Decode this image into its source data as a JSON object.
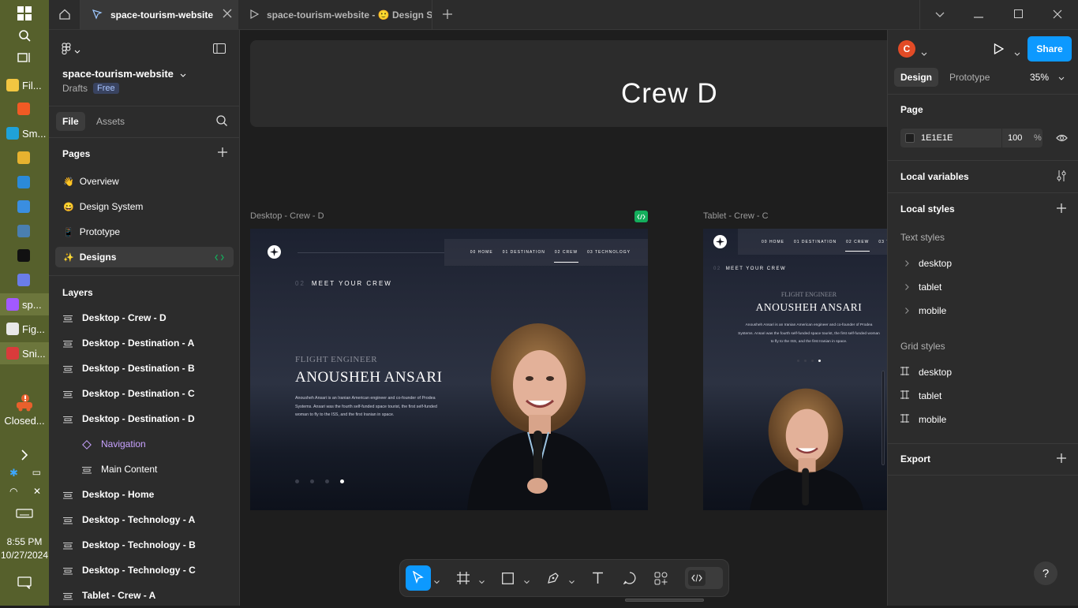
{
  "taskbar": {
    "apps": [
      {
        "label": "Fil...",
        "icon": "folder-icon",
        "color": "#f2c641"
      },
      {
        "label": "",
        "icon": "brave-icon",
        "color": "#f15a24"
      },
      {
        "label": "Sm...",
        "icon": "edge-icon",
        "color": "#1fa2d8"
      },
      {
        "label": "",
        "icon": "chrome-icon",
        "color": "#e7b22f"
      },
      {
        "label": "",
        "icon": "vscode-icon",
        "color": "#2b8ad8"
      },
      {
        "label": "",
        "icon": "store-icon",
        "color": "#3a8ee0"
      },
      {
        "label": "",
        "icon": "python-icon",
        "color": "#4a7fb0"
      },
      {
        "label": "",
        "icon": "app-icon",
        "color": "#111111"
      },
      {
        "label": "",
        "icon": "copilot-icon",
        "color": "#6a7de8"
      },
      {
        "label": "sp...",
        "icon": "figma-icon",
        "color": "#a259ff"
      },
      {
        "label": "Fig...",
        "icon": "figma-window-icon",
        "color": "#e8e8e8"
      },
      {
        "label": "Sni...",
        "icon": "snipping-icon",
        "color": "#d93b3b"
      }
    ],
    "closed_label": "Closed...",
    "time": "8:55 PM",
    "date": "10/27/2024"
  },
  "tabs": {
    "active": "space-tourism-website",
    "inactive": "space-tourism-website - 🙂 Design S"
  },
  "left": {
    "file_name": "space-tourism-website",
    "drafts": "Drafts",
    "plan": "Free",
    "file_tab": "File",
    "assets_tab": "Assets",
    "pages_title": "Pages",
    "pages": [
      {
        "emoji": "👋",
        "label": "Overview"
      },
      {
        "emoji": "😀",
        "label": "Design System"
      },
      {
        "emoji": "📱",
        "label": "Prototype"
      },
      {
        "emoji": "✨",
        "label": "Designs"
      }
    ],
    "layers_title": "Layers",
    "layers": [
      {
        "label": "Desktop - Crew - D",
        "indent": 0,
        "kind": "frame"
      },
      {
        "label": "Desktop - Destination - A",
        "indent": 0,
        "kind": "frame"
      },
      {
        "label": "Desktop - Destination - B",
        "indent": 0,
        "kind": "frame"
      },
      {
        "label": "Desktop - Destination - C",
        "indent": 0,
        "kind": "frame"
      },
      {
        "label": "Desktop - Destination - D",
        "indent": 0,
        "kind": "frame"
      },
      {
        "label": "Navigation",
        "indent": 1,
        "kind": "component"
      },
      {
        "label": "Main Content",
        "indent": 1,
        "kind": "frame"
      },
      {
        "label": "Desktop - Home",
        "indent": 0,
        "kind": "frame"
      },
      {
        "label": "Desktop - Technology - A",
        "indent": 0,
        "kind": "frame"
      },
      {
        "label": "Desktop - Technology - B",
        "indent": 0,
        "kind": "frame"
      },
      {
        "label": "Desktop - Technology - C",
        "indent": 0,
        "kind": "frame"
      },
      {
        "label": "Tablet - Crew - A",
        "indent": 0,
        "kind": "frame"
      }
    ]
  },
  "canvas": {
    "section_title": "Crew D",
    "desktop_frame_label": "Desktop - Crew - D",
    "tablet_frame_label": "Tablet - Crew - C",
    "nav": [
      "00 HOME",
      "01 DESTINATION",
      "02 CREW",
      "03 TECHNOLOGY"
    ],
    "eyebrow_num": "02",
    "eyebrow": "MEET YOUR CREW",
    "role": "FLIGHT ENGINEER",
    "name": "ANOUSHEH ANSARI",
    "bio": "Anousheh Ansari is an Iranian American engineer and co-founder of Prodea Systems. Ansari was the fourth self-funded space tourist, the first self-funded woman to fly to the ISS, and the first Iranian in space."
  },
  "right": {
    "avatar_letter": "C",
    "share": "Share",
    "design_tab": "Design",
    "prototype_tab": "Prototype",
    "zoom": "35%",
    "page_title": "Page",
    "page_color": "1E1E1E",
    "page_opacity": "100",
    "percent": "%",
    "local_variables": "Local variables",
    "local_styles": "Local styles",
    "text_styles_title": "Text styles",
    "text_styles": [
      "desktop",
      "tablet",
      "mobile"
    ],
    "grid_styles_title": "Grid styles",
    "grid_styles": [
      "desktop",
      "tablet",
      "mobile"
    ],
    "export": "Export",
    "help": "?"
  },
  "colors": {
    "accent": "#0d99ff",
    "avatar": "#e24b26",
    "dev_badge": "#14ae5c",
    "component": "#c8a2ff"
  }
}
